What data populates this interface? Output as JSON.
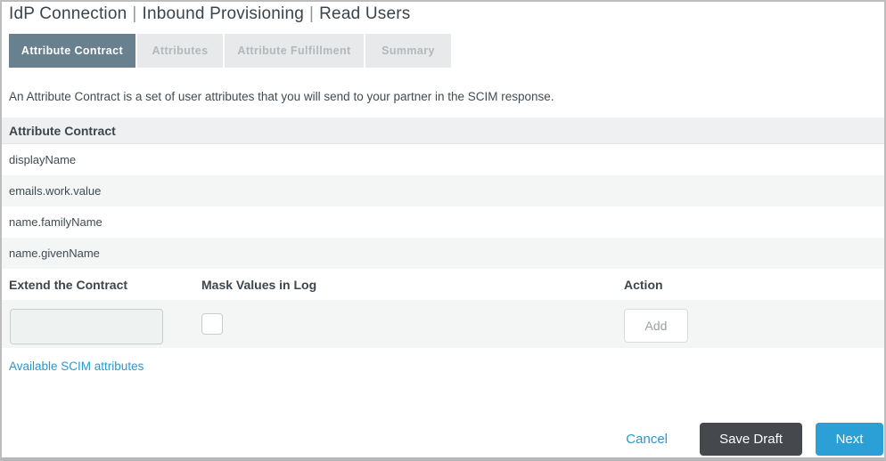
{
  "header": {
    "segments": [
      "IdP Connection",
      "Inbound Provisioning",
      "Read Users"
    ],
    "separator": "|"
  },
  "tabs": [
    {
      "label": "Attribute Contract",
      "active": true
    },
    {
      "label": "Attributes",
      "active": false
    },
    {
      "label": "Attribute Fulfillment",
      "active": false
    },
    {
      "label": "Summary",
      "active": false
    }
  ],
  "description": "An Attribute Contract is a set of user attributes that you will send to your partner in the SCIM response.",
  "contract": {
    "header": "Attribute Contract",
    "rows": [
      "displayName",
      "emails.work.value",
      "name.familyName",
      "name.givenName"
    ]
  },
  "extend": {
    "col_extend": "Extend the Contract",
    "col_mask": "Mask Values in Log",
    "col_action": "Action",
    "input_value": "",
    "mask_checked": false,
    "add_label": "Add",
    "scim_link": "Available SCIM attributes"
  },
  "footer": {
    "cancel": "Cancel",
    "save_draft": "Save Draft",
    "next": "Next"
  },
  "colors": {
    "active_tab": "#69808e",
    "accent_blue": "#2aa0d6",
    "link_blue": "#2798d4",
    "save_draft_gray": "#45494e"
  }
}
